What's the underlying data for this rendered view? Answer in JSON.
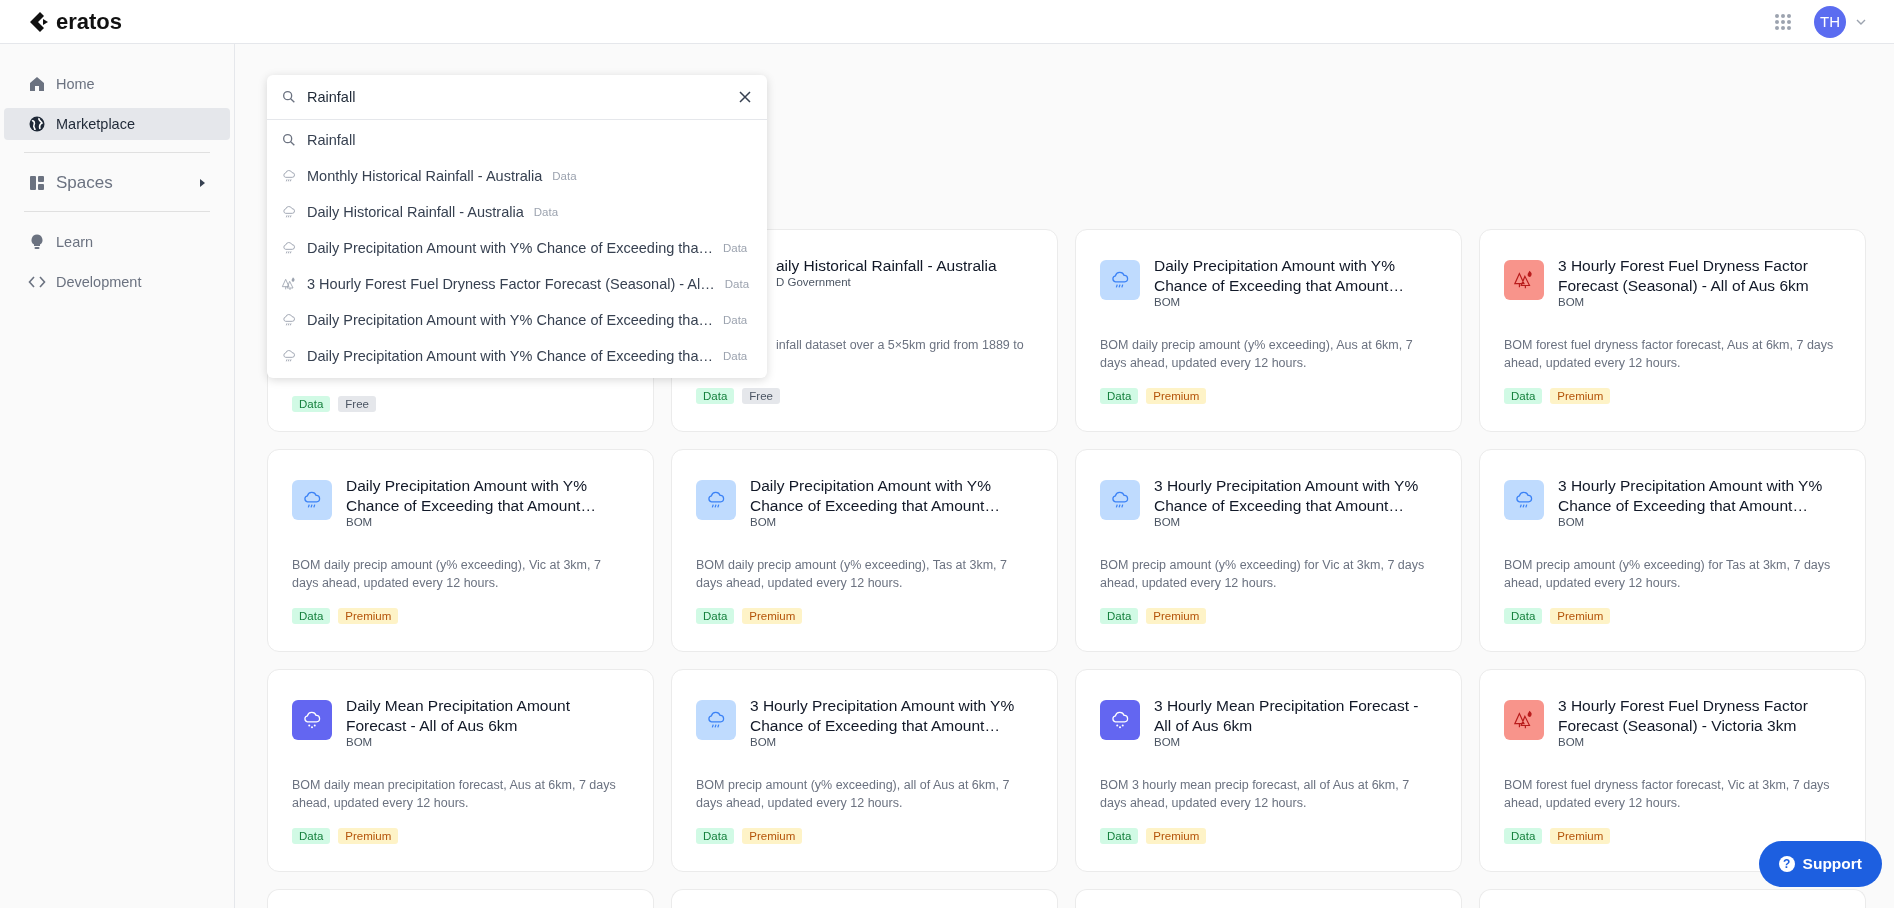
{
  "header": {
    "logo": "eratos",
    "avatar": "TH"
  },
  "sidebar": {
    "sections": [
      [
        {
          "kind": "home",
          "label": "Home",
          "selected": false
        },
        {
          "kind": "globe",
          "label": "Marketplace",
          "selected": true
        }
      ],
      [
        {
          "kind": "spaces",
          "label": "Spaces",
          "selected": false,
          "expanded": false
        }
      ],
      [
        {
          "kind": "bulb",
          "label": "Learn",
          "selected": false
        },
        {
          "kind": "code",
          "label": "Development",
          "selected": false
        }
      ]
    ]
  },
  "search": {
    "value": "Rainfall",
    "results": [
      {
        "kind": "query",
        "label": "Rainfall"
      },
      {
        "kind": "rain",
        "label": "Monthly Historical Rainfall - Australia",
        "tag": "Data"
      },
      {
        "kind": "rain",
        "label": "Daily Historical Rainfall - Australia",
        "tag": "Data"
      },
      {
        "kind": "rain",
        "label": "Daily Precipitation Amount with Y% Chance of Exceeding tha…",
        "tag": "Data"
      },
      {
        "kind": "fire",
        "label": "3 Hourly Forest Fuel Dryness Factor Forecast (Seasonal) - Al…",
        "tag": "Data"
      },
      {
        "kind": "rain",
        "label": "Daily Precipitation Amount with Y% Chance of Exceeding tha…",
        "tag": "Data"
      },
      {
        "kind": "rain",
        "label": "Daily Precipitation Amount with Y% Chance of Exceeding tha…",
        "tag": "Data"
      }
    ]
  },
  "cards": [
    {
      "kind": "covered",
      "tags": [
        {
          "kind": "data",
          "label": "Data"
        },
        {
          "kind": "free",
          "label": "Free"
        }
      ]
    },
    {
      "kind": "cut",
      "title": "aily Historical Rainfall - Australia",
      "publisher": "D Government",
      "description": "infall dataset over a 5×5km grid from 1889 to",
      "tags": [
        {
          "kind": "data",
          "label": "Data"
        },
        {
          "kind": "free",
          "label": "Free"
        }
      ]
    },
    {
      "kind": "rain",
      "title": "Daily Precipitation Amount with Y% Chance of Exceeding that Amount…",
      "publisher": "BOM",
      "description": "BOM daily precip amount (y% exceeding), Aus at 6km, 7 days ahead, updated every 12 hours.",
      "tags": [
        {
          "kind": "data",
          "label": "Data"
        },
        {
          "kind": "premium",
          "label": "Premium"
        }
      ]
    },
    {
      "kind": "fire",
      "title": "3 Hourly Forest Fuel Dryness Factor Forecast (Seasonal) - All of Aus 6km",
      "publisher": "BOM",
      "description": "BOM forest fuel dryness factor forecast, Aus at 6km, 7 days ahead, updated every 12 hours.",
      "tags": [
        {
          "kind": "data",
          "label": "Data"
        },
        {
          "kind": "premium",
          "label": "Premium"
        }
      ]
    },
    {
      "kind": "rain",
      "title": "Daily Precipitation Amount with Y% Chance of Exceeding that Amount…",
      "publisher": "BOM",
      "description": "BOM daily precip amount (y% exceeding), Vic at 3km, 7 days ahead, updated every 12 hours.",
      "tags": [
        {
          "kind": "data",
          "label": "Data"
        },
        {
          "kind": "premium",
          "label": "Premium"
        }
      ]
    },
    {
      "kind": "rain",
      "title": "Daily Precipitation Amount with Y% Chance of Exceeding that Amount…",
      "publisher": "BOM",
      "description": "BOM daily precip amount (y% exceeding), Tas at 3km, 7 days ahead, updated every 12 hours.",
      "tags": [
        {
          "kind": "data",
          "label": "Data"
        },
        {
          "kind": "premium",
          "label": "Premium"
        }
      ]
    },
    {
      "kind": "rain",
      "title": "3 Hourly Precipitation Amount with Y% Chance of Exceeding that Amount…",
      "publisher": "BOM",
      "description": "BOM precip amount (y% exceeding) for Vic at 3km, 7 days ahead, updated every 12 hours.",
      "tags": [
        {
          "kind": "data",
          "label": "Data"
        },
        {
          "kind": "premium",
          "label": "Premium"
        }
      ]
    },
    {
      "kind": "rain",
      "title": "3 Hourly Precipitation Amount with Y% Chance of Exceeding that Amount…",
      "publisher": "BOM",
      "description": "BOM precip amount (y% exceeding) for Tas at 3km, 7 days ahead, updated every 12 hours.",
      "tags": [
        {
          "kind": "data",
          "label": "Data"
        },
        {
          "kind": "premium",
          "label": "Premium"
        }
      ]
    },
    {
      "kind": "snow",
      "title": "Daily Mean Precipitation Amount Forecast - All of Aus 6km",
      "publisher": "BOM",
      "description": "BOM daily mean precipitation forecast, Aus at 6km, 7 days ahead, updated every 12 hours.",
      "tags": [
        {
          "kind": "data",
          "label": "Data"
        },
        {
          "kind": "premium",
          "label": "Premium"
        }
      ]
    },
    {
      "kind": "rain",
      "title": "3 Hourly Precipitation Amount with Y% Chance of Exceeding that Amount…",
      "publisher": "BOM",
      "description": "BOM precip amount (y% exceeding), all of Aus at 6km, 7 days ahead, updated every 12 hours.",
      "tags": [
        {
          "kind": "data",
          "label": "Data"
        },
        {
          "kind": "premium",
          "label": "Premium"
        }
      ]
    },
    {
      "kind": "snow",
      "title": "3 Hourly Mean Precipitation Forecast - All of Aus 6km",
      "publisher": "BOM",
      "description": "BOM 3 hourly mean precip forecast, all of Aus at 6km, 7 days ahead, updated every 12 hours.",
      "tags": [
        {
          "kind": "data",
          "label": "Data"
        },
        {
          "kind": "premium",
          "label": "Premium"
        }
      ]
    },
    {
      "kind": "fire",
      "title": "3 Hourly Forest Fuel Dryness Factor Forecast (Seasonal) - Victoria 3km",
      "publisher": "BOM",
      "description": "BOM forest fuel dryness factor forecast, Vic at 3km, 7 days ahead, updated every 12 hours.",
      "tags": [
        {
          "kind": "data",
          "label": "Data"
        },
        {
          "kind": "premium",
          "label": "Premium"
        }
      ]
    },
    {
      "kind": "empty"
    },
    {
      "kind": "empty"
    },
    {
      "kind": "empty"
    },
    {
      "kind": "empty"
    }
  ],
  "support": {
    "icon": "?",
    "label": "Support"
  }
}
